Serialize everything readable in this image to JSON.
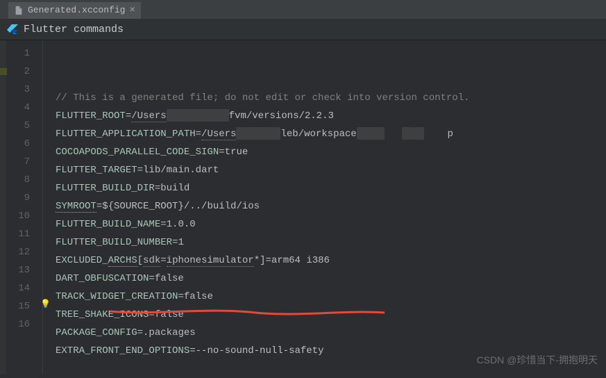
{
  "tab": {
    "filename": "Generated.xcconfig"
  },
  "banner": {
    "label": "Flutter commands"
  },
  "code": {
    "lines": [
      {
        "n": 1,
        "segs": [
          {
            "t": "// This is a generated file; do not edit or check into version control.",
            "cls": "cm"
          }
        ]
      },
      {
        "n": 2,
        "segs": [
          {
            "t": "FLUTTER_ROOT",
            "cls": "kw"
          },
          {
            "t": "=",
            "cls": "eq"
          },
          {
            "t": "/Users",
            "cls": "squiggle-g"
          },
          {
            "redacted": "r1"
          },
          {
            "t": "fvm/versions/2.2.3",
            "cls": "val"
          }
        ]
      },
      {
        "n": 3,
        "segs": [
          {
            "t": "FLUTTER_APPLICATION_PATH",
            "cls": "kw"
          },
          {
            "t": "=",
            "cls": "eq"
          },
          {
            "t": "/Users",
            "cls": "squiggle-g"
          },
          {
            "redacted": "r2"
          },
          {
            "t": "leb/workspace",
            "cls": "val"
          },
          {
            "redacted": "r3"
          },
          {
            "t": "   ",
            "cls": "val"
          },
          {
            "redacted": "r4"
          },
          {
            "redacted": "r4"
          },
          {
            "t": "    p",
            "cls": "val"
          }
        ]
      },
      {
        "n": 4,
        "segs": [
          {
            "t": "COCOAPODS_PARALLEL_CODE_SIGN",
            "cls": "kw"
          },
          {
            "t": "=",
            "cls": "eq"
          },
          {
            "t": "true",
            "cls": "val"
          }
        ]
      },
      {
        "n": 5,
        "segs": [
          {
            "t": "FLUTTER_TARGET",
            "cls": "kw"
          },
          {
            "t": "=",
            "cls": "eq"
          },
          {
            "t": "lib/main.dart",
            "cls": "val"
          }
        ]
      },
      {
        "n": 6,
        "segs": [
          {
            "t": "FLUTTER_BUILD_DIR",
            "cls": "kw"
          },
          {
            "t": "=",
            "cls": "eq"
          },
          {
            "t": "build",
            "cls": "val"
          }
        ]
      },
      {
        "n": 7,
        "segs": [
          {
            "t": "SYMROOT",
            "cls": "kw squiggle-y"
          },
          {
            "t": "=",
            "cls": "eq"
          },
          {
            "t": "${SOURCE_ROOT}/../build/ios",
            "cls": "val"
          }
        ]
      },
      {
        "n": 8,
        "segs": [
          {
            "t": "FLUTTER_BUILD_NAME",
            "cls": "kw"
          },
          {
            "t": "=",
            "cls": "eq"
          },
          {
            "t": "1.0.0",
            "cls": "val"
          }
        ]
      },
      {
        "n": 9,
        "segs": [
          {
            "t": "FLUTTER_BUILD_NUMBER",
            "cls": "kw"
          },
          {
            "t": "=",
            "cls": "eq"
          },
          {
            "t": "1",
            "cls": "val"
          }
        ]
      },
      {
        "n": 10,
        "segs": [
          {
            "t": "EXCLUDED_",
            "cls": "kw"
          },
          {
            "t": "ARCHS",
            "cls": "kw squiggle-y"
          },
          {
            "t": "[",
            "cls": "eq"
          },
          {
            "t": "sdk",
            "cls": "squiggle-g"
          },
          {
            "t": "=",
            "cls": "eq"
          },
          {
            "t": "iphonesimulator",
            "cls": "squiggle-g"
          },
          {
            "t": "*]=arm64 i386",
            "cls": "val"
          }
        ]
      },
      {
        "n": 11,
        "segs": [
          {
            "t": "DART_OBFUSCATION",
            "cls": "kw"
          },
          {
            "t": "=",
            "cls": "eq"
          },
          {
            "t": "false",
            "cls": "val"
          }
        ]
      },
      {
        "n": 12,
        "segs": [
          {
            "t": "TRACK_WIDGET_CREATION",
            "cls": "kw"
          },
          {
            "t": "=",
            "cls": "eq"
          },
          {
            "t": "false",
            "cls": "val"
          }
        ]
      },
      {
        "n": 13,
        "segs": [
          {
            "t": "TREE_SHAKE_ICONS",
            "cls": "kw"
          },
          {
            "t": "=",
            "cls": "eq"
          },
          {
            "t": "false",
            "cls": "val"
          }
        ]
      },
      {
        "n": 14,
        "segs": [
          {
            "t": "PACKAGE_CONFIG",
            "cls": "kw"
          },
          {
            "t": "=",
            "cls": "eq"
          },
          {
            "t": ".packages",
            "cls": "val"
          }
        ]
      },
      {
        "n": 15,
        "segs": [
          {
            "t": "EXTRA_FRONT_END_OPTIONS",
            "cls": "kw"
          },
          {
            "t": "=",
            "cls": "eq"
          },
          {
            "t": "--no-sound-null-safety",
            "cls": "val"
          }
        ]
      },
      {
        "n": 16,
        "segs": []
      }
    ]
  },
  "watermark": "CSDN @珍惜当下-拥抱明天"
}
